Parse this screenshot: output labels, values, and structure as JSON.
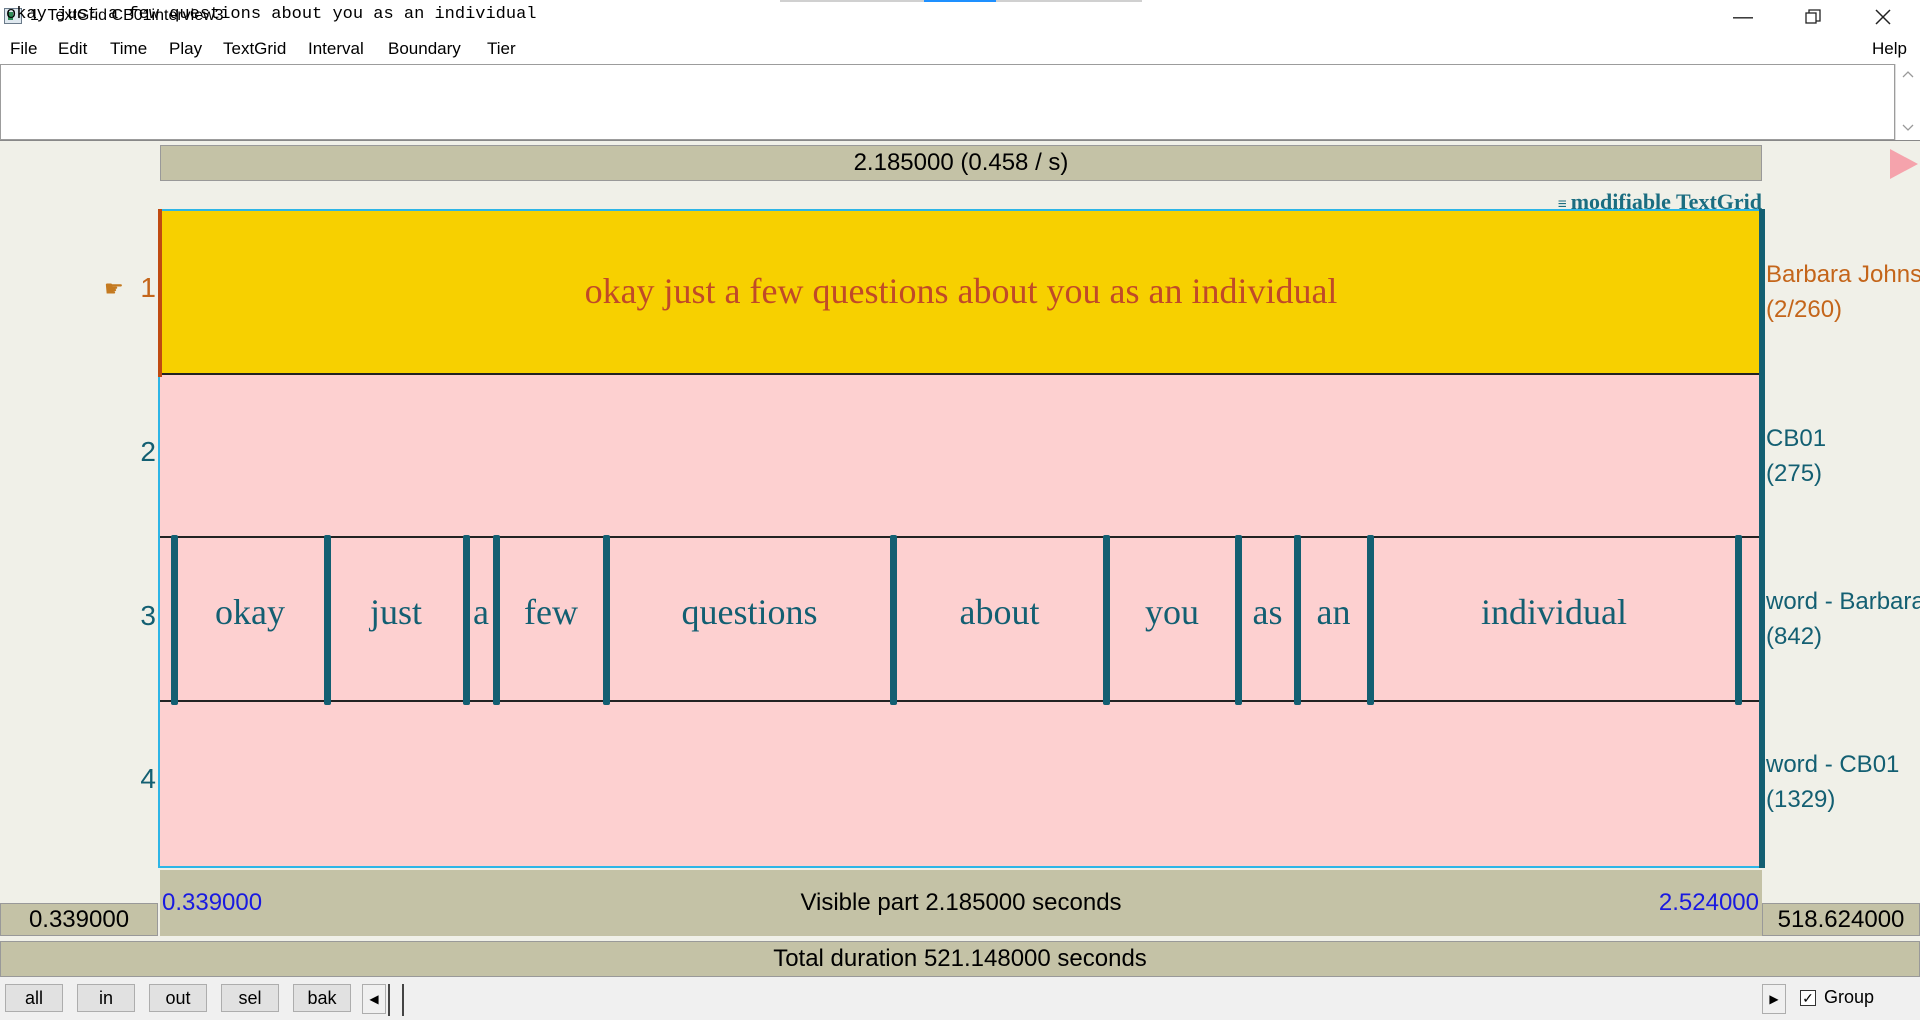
{
  "window": {
    "title": "1. TextGrid CB01interview3",
    "minimize_icon": "minimize-icon",
    "maximize_icon": "restore-icon",
    "close_icon": "close-icon"
  },
  "menu": {
    "items": [
      "File",
      "Edit",
      "Time",
      "Play",
      "TextGrid",
      "Interval",
      "Boundary",
      "Tier"
    ],
    "help": "Help"
  },
  "text_field": {
    "value": "okay just a few questions about you as an individual"
  },
  "selection_bar": {
    "label": "2.185000 (0.458 / s)"
  },
  "badge": {
    "label": "modifiable TextGrid"
  },
  "tiers": [
    {
      "number": "1",
      "name": "Barbara Johns",
      "count": "(2/260)",
      "text": "okay just a few questions about you as an individual"
    },
    {
      "number": "2",
      "name": "CB01",
      "count": "(275)"
    },
    {
      "number": "3",
      "name": "word - Barbara",
      "count": "(842)"
    },
    {
      "number": "4",
      "name": "word - CB01",
      "count": "(1329)"
    }
  ],
  "words": [
    "okay",
    "just",
    "a",
    "few",
    "questions",
    "about",
    "you",
    "as",
    "an",
    "individual"
  ],
  "time": {
    "visible_start": "0.339000",
    "visible_end": "2.524000",
    "visible_label": "Visible part 2.185000 seconds",
    "left_outside": "0.339000",
    "right_outside": "518.624000",
    "total_label": "Total duration 521.148000 seconds"
  },
  "buttons": {
    "all": "all",
    "in": "in",
    "out": "out",
    "sel": "sel",
    "bak": "bak"
  },
  "group": {
    "label": "Group",
    "checked": true
  }
}
